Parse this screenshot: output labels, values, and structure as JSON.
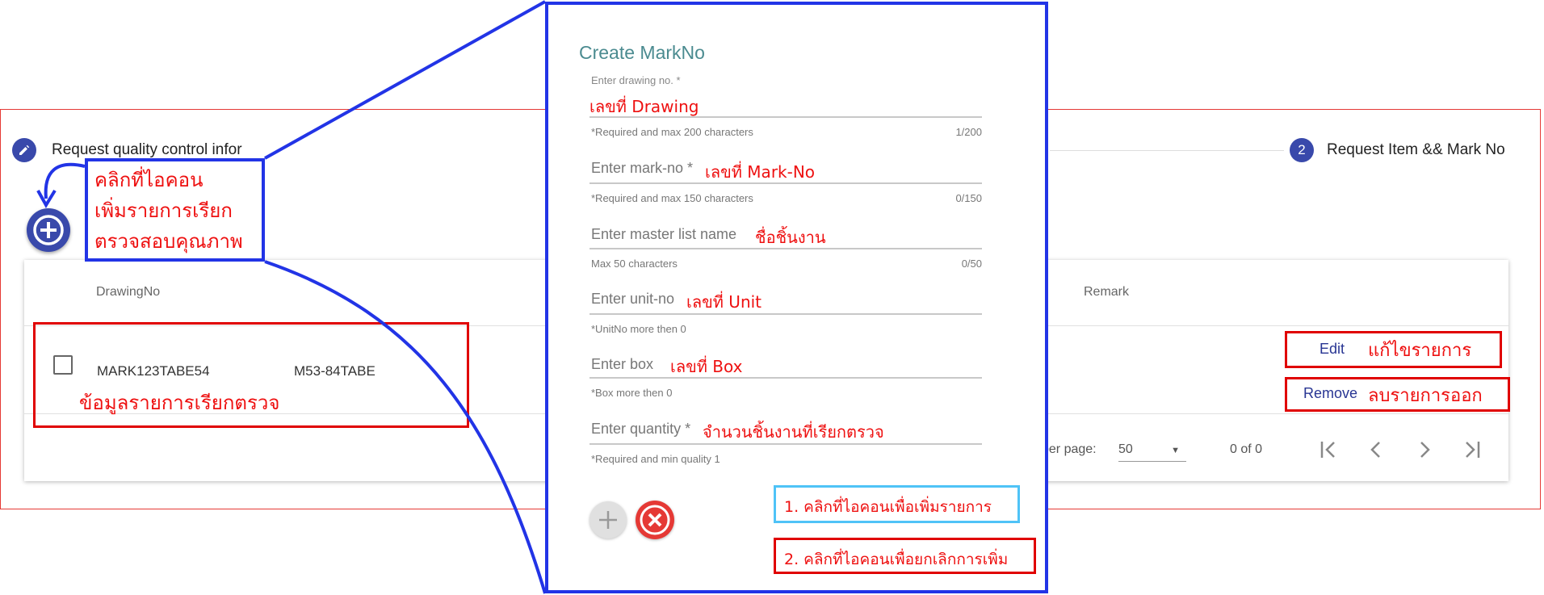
{
  "stepper": {
    "step1_label": "Request quality control infor",
    "step2_number": "2",
    "step2_label": "Request Item && Mark No"
  },
  "table": {
    "columns": [
      "DrawingNo",
      "Remark"
    ],
    "rows": [
      {
        "drawing_no": "MARK123TABE54",
        "mark_no": "M53-84TABE"
      }
    ],
    "actions": {
      "edit": "Edit",
      "remove": "Remove"
    }
  },
  "pagination": {
    "per_page_label": "per page:",
    "per_page_value": "50",
    "range": "0 of 0"
  },
  "annotations": {
    "add_icon_note": [
      "คลิกที่ไอคอน",
      "เพิ่มรายการเรียก",
      "ตรวจสอบคุณภาพ"
    ],
    "row_note": "ข้อมูลรายการเรียกตรวจ",
    "edit_note": "แก้ไขรายการ",
    "remove_note": "ลบรายการออก",
    "add_callout": "1. คลิกที่ไอคอนเพื่อเพิ่มรายการ",
    "cancel_callout": "2. คลิกที่ไอคอนเพื่อยกเลิกการเพิ่ม"
  },
  "dialog": {
    "title": "Create MarkNo",
    "fields": [
      {
        "label": "Enter drawing no. *",
        "value": "เลขที่ Drawing",
        "hint": "*Required and max 200 characters",
        "counter": "1/200"
      },
      {
        "label": "Enter mark-no *",
        "value": "เลขที่ Mark-No",
        "hint": "*Required and max 150 characters",
        "counter": "0/150"
      },
      {
        "label": "Enter master list name",
        "value": "ชื่อชิ้นงาน",
        "hint": "Max 50 characters",
        "counter": "0/50"
      },
      {
        "label": "Enter unit-no",
        "value": "เลขที่ Unit",
        "hint": "*UnitNo more then 0",
        "counter": ""
      },
      {
        "label": "Enter box",
        "value": "เลขที่ Box",
        "hint": "*Box more then 0",
        "counter": ""
      },
      {
        "label": "Enter quantity *",
        "value": "จำนวนชิ้นงานที่เรียกตรวจ",
        "hint": "*Required and min quality 1",
        "counter": ""
      }
    ]
  },
  "colors": {
    "primary": "#3949ab",
    "annotation_red": "#e00000",
    "annotation_blue": "#2234e6",
    "callout_light_blue": "#4fc3f7",
    "dialog_title": "#4b8b90",
    "cancel_red": "#e53935"
  },
  "icons": [
    "pencil-icon",
    "add-circle-icon",
    "first-page-icon",
    "prev-page-icon",
    "next-page-icon",
    "last-page-icon",
    "dropdown-arrow-icon",
    "add-icon",
    "cancel-icon"
  ]
}
